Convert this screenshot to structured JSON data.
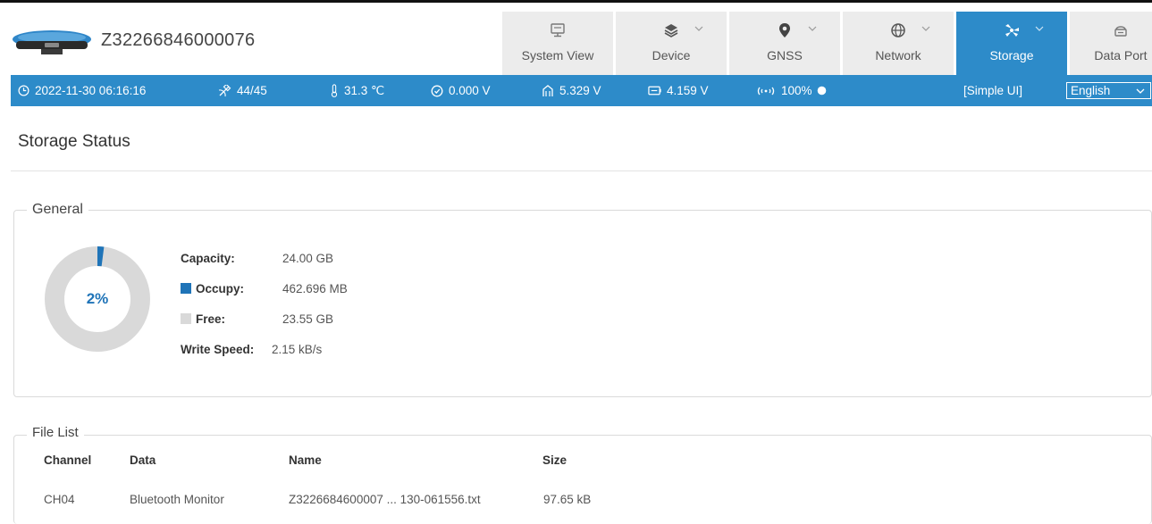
{
  "header": {
    "device_id": "Z32266846000076",
    "tabs": [
      {
        "label": "System View",
        "icon": "monitor-icon",
        "has_dropdown": false
      },
      {
        "label": "Device",
        "icon": "layers-icon",
        "has_dropdown": true
      },
      {
        "label": "GNSS",
        "icon": "location-pin-icon",
        "has_dropdown": true
      },
      {
        "label": "Network",
        "icon": "globe-icon",
        "has_dropdown": true
      },
      {
        "label": "Storage",
        "icon": "storage-icon",
        "has_dropdown": true,
        "active": true
      },
      {
        "label": "Data Port",
        "icon": "port-icon",
        "has_dropdown": true
      }
    ]
  },
  "status_bar": {
    "datetime": "2022-11-30 06:16:16",
    "satellites": "44/45",
    "temperature": "31.3 ℃",
    "voltage_1": "0.000 V",
    "voltage_2": "5.329 V",
    "voltage_3": "4.159 V",
    "signal": "100%",
    "simple_ui": "[Simple UI]",
    "language": "English"
  },
  "page": {
    "title": "Storage Status"
  },
  "general": {
    "legend": "General",
    "usage_percent_label": "2%",
    "usage_fraction": 0.02,
    "capacity_label": "Capacity:",
    "capacity_value": "24.00 GB",
    "occupy_label": "Occupy:",
    "occupy_value": "462.696 MB",
    "free_label": "Free:",
    "free_value": "23.55 GB",
    "write_speed_label": "Write Speed:",
    "write_speed_value": "2.15 kB/s"
  },
  "file_list": {
    "legend": "File List",
    "columns": [
      "Channel",
      "Data",
      "Name",
      "Size"
    ],
    "rows": [
      {
        "channel": "CH04",
        "data": "Bluetooth Monitor",
        "name": "Z3226684600007 ... 130-061556.txt",
        "size": "97.65 kB"
      }
    ]
  },
  "colors": {
    "accent": "#2d8bc9",
    "occupy": "#1f74b8",
    "free": "#d9d9d9",
    "tab_bg": "#ececec"
  }
}
